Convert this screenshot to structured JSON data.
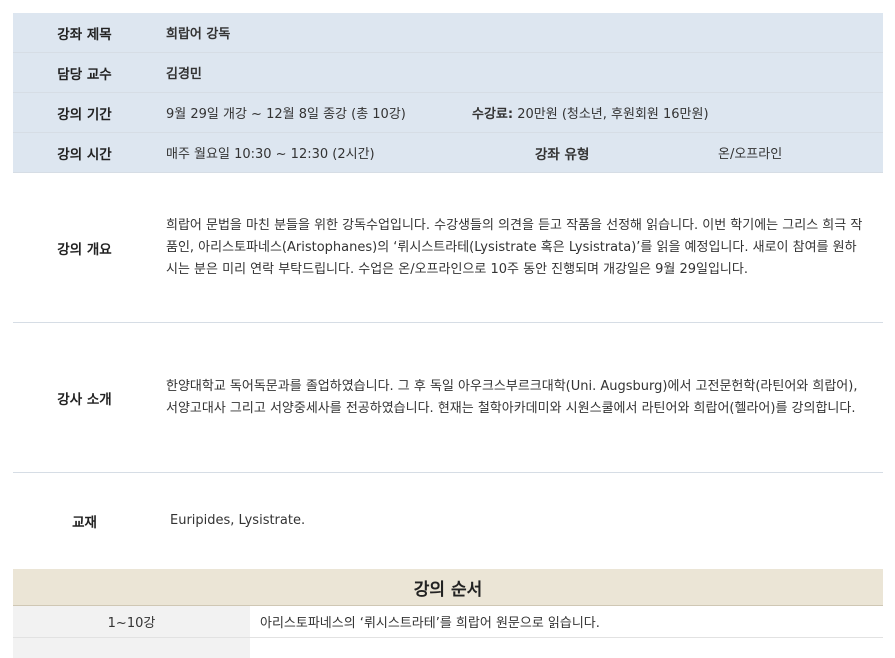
{
  "course": {
    "title_label": "강좌 제목",
    "title_value": "희랍어 강독",
    "instructor_label": "담당 교수",
    "instructor_value": "김경민",
    "period_label": "강의 기간",
    "period_value": "9월 29일 개강 ~ 12월 8일 종강 (총 10강)",
    "fee_label": "수강료:",
    "fee_value": " 20만원 (청소년, 후원회원 16만원)",
    "time_label": "강의 시간",
    "time_value": "매주 월요일 10:30 ~ 12:30 (2시간)",
    "type_label": "강좌 유형",
    "type_value": "온/오프라인",
    "overview_label": "강의 개요",
    "overview_value": "희랍어 문법을 마친 분들을 위한 강독수업입니다. 수강생들의 의견을 듣고 작품을 선정해 읽습니다. 이번 학기에는 그리스 희극 작품인, 아리스토파네스(Aristophanes)의 ‘뤼시스트라테(Lysistrate 혹은 Lysistrata)’를 읽을 예정입니다. 새로이 참여를 원하시는 분은 미리 연락 부탁드립니다. 수업은 온/오프라인으로 10주 동안 진행되며 개강일은 9월 29일입니다.",
    "instructor_intro_label": "강사 소개",
    "instructor_intro_value": "한양대학교 독어독문과를 졸업하였습니다. 그 후 독일 아우크스부르크대학(Uni. Augsburg)에서 고전문헌학(라틴어와 희랍어), 서양고대사 그리고 서양중세사를 전공하였습니다. 현재는 철학아카데미와 시원스쿨에서 라틴어와 희랍어(헬라어)를 강의합니다.",
    "textbook_label": "교재",
    "textbook_value": "Euripides, Lysistrate."
  },
  "order": {
    "title": "강의 순서",
    "rows": [
      {
        "num": "1~10강",
        "desc": "아리스토파네스의 ‘뤼시스트라테’를 희랍어 원문으로 읽습니다."
      }
    ]
  }
}
